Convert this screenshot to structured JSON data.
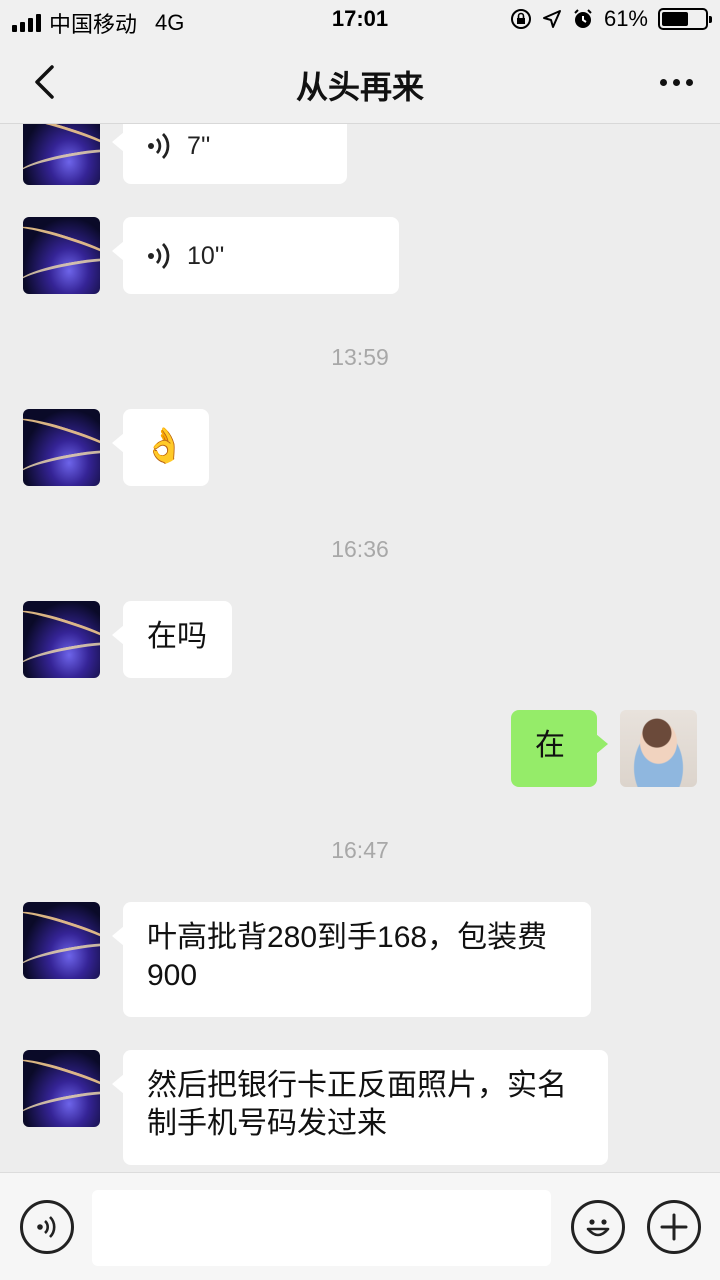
{
  "status_bar": {
    "carrier": "中国移动",
    "network": "4G",
    "time": "17:01",
    "battery": "61%",
    "battery_level": 0.61
  },
  "nav": {
    "title": "从头再来",
    "back_icon": "chevron-left-icon",
    "more_icon": "more-dots-icon"
  },
  "messages": [
    {
      "type": "voice",
      "side": "left",
      "duration": "7''"
    },
    {
      "type": "voice",
      "side": "left",
      "duration": "10''"
    },
    {
      "type": "time",
      "text": "13:59"
    },
    {
      "type": "emoji",
      "side": "left",
      "text": "👌"
    },
    {
      "type": "time",
      "text": "16:36"
    },
    {
      "type": "text",
      "side": "left",
      "text": "在吗"
    },
    {
      "type": "text",
      "side": "right",
      "text": "在"
    },
    {
      "type": "time",
      "text": "16:47"
    },
    {
      "type": "text",
      "side": "left",
      "line1": "叶高批背280到手168，包装费",
      "line2": "900"
    },
    {
      "type": "text",
      "side": "left",
      "line1": "然后把银行卡正反面照片，实名",
      "line2": "制手机号码发过来"
    }
  ],
  "input_bar": {
    "voice_icon": "voice-input-icon",
    "emoji_icon": "smiley-icon",
    "plus_icon": "plus-icon",
    "placeholder": ""
  },
  "colors": {
    "background": "#ededed",
    "bubble_self": "#95ec69",
    "bubble_other": "#ffffff",
    "timestamp": "#a8a8a8"
  }
}
